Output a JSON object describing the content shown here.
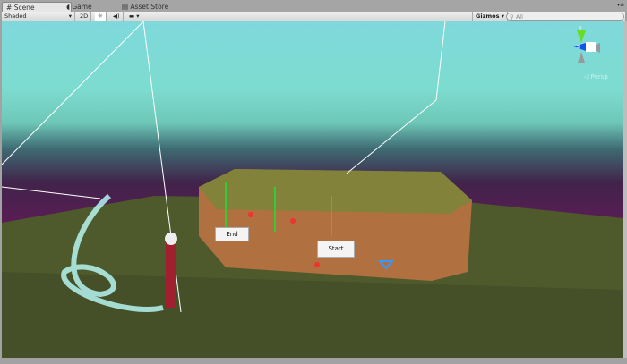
{
  "tabs": [
    {
      "label": "Scene",
      "icon": "grid-icon",
      "active": true
    },
    {
      "label": "Game",
      "icon": "pacman-icon",
      "active": false
    },
    {
      "label": "Asset Store",
      "icon": "bag-icon",
      "active": false
    }
  ],
  "toolbar": {
    "shading_mode": "Shaded",
    "mode_2d": "2D",
    "lighting_icon": "sun-icon",
    "audio_icon": "speaker-icon",
    "effects_icon": "image-icon",
    "gizmos": "Gizmos",
    "search_placeholder": "All"
  },
  "scene": {
    "labels": {
      "end": "End",
      "start": "Start"
    },
    "gizmo": {
      "y_axis": "y",
      "z_axis": "z",
      "projection": "Persp"
    }
  },
  "colors": {
    "sky": "#7fd9db",
    "horizon": "#41234a",
    "ground": "#4f5a2c",
    "platform": "#b0703f"
  }
}
